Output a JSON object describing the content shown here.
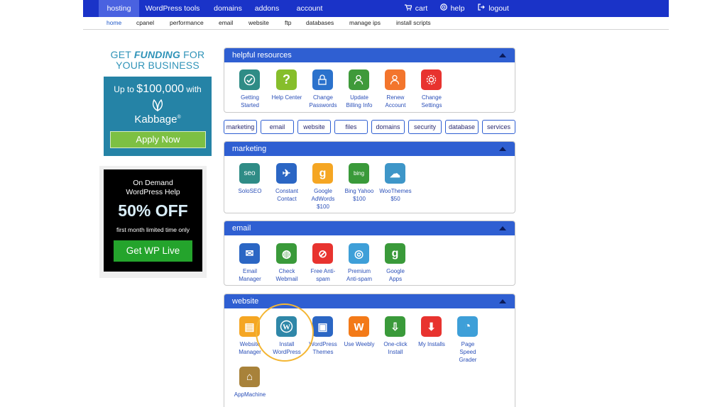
{
  "topnav": {
    "items": [
      {
        "label": "hosting"
      },
      {
        "label": "WordPress tools"
      },
      {
        "label": "domains"
      },
      {
        "label": "addons"
      },
      {
        "label": "account"
      }
    ],
    "cart": "cart",
    "help": "help",
    "logout": "logout"
  },
  "subnav": {
    "items": [
      {
        "label": "home"
      },
      {
        "label": "cpanel"
      },
      {
        "label": "performance"
      },
      {
        "label": "email"
      },
      {
        "label": "website"
      },
      {
        "label": "ftp"
      },
      {
        "label": "databases"
      },
      {
        "label": "manage ips"
      },
      {
        "label": "install scripts"
      }
    ]
  },
  "ads": {
    "kabbage": {
      "line1_pre": "GET ",
      "line1_bold": "FUNDING",
      "line1_post": " FOR",
      "line2": "YOUR BUSINESS",
      "upto": "Up to ",
      "amount": "$100,000",
      "with": " with",
      "brand": "Kabbage",
      "trademark": "®",
      "button": "Apply Now"
    },
    "wplive": {
      "line1": "On Demand",
      "line2": "WordPress Help",
      "offer": "50% OFF",
      "note": "first month limited time only",
      "button": "Get WP Live"
    }
  },
  "panels": {
    "helpful": {
      "title": "helpful resources",
      "tiles": [
        {
          "line1": "Getting",
          "line2": "Started",
          "icon": "checkmark-icon",
          "color": "#2f8c86"
        },
        {
          "line1": "Help Center",
          "line2": "",
          "icon": "question-icon",
          "color": "#86be2b"
        },
        {
          "line1": "Change",
          "line2": "Passwords",
          "icon": "lock-gear-icon",
          "color": "#2b72cc"
        },
        {
          "line1": "Update",
          "line2": "Billing Info",
          "icon": "user-gear-icon",
          "color": "#3f9a3a"
        },
        {
          "line1": "Renew",
          "line2": "Account",
          "icon": "user-clock-icon",
          "color": "#f3752c"
        },
        {
          "line1": "Change",
          "line2": "Settings",
          "icon": "gear-icon",
          "color": "#e8332f"
        }
      ]
    },
    "tags": [
      "marketing",
      "email",
      "website",
      "files",
      "domains",
      "security",
      "database",
      "services"
    ],
    "marketing": {
      "title": "marketing",
      "tiles": [
        {
          "line1": "SoloSEO",
          "line2": "",
          "line3": "",
          "glyph": "seo",
          "icon": "seo-icon",
          "color": "#2f8c86"
        },
        {
          "line1": "Constant",
          "line2": "Contact",
          "line3": "",
          "glyph": "✈",
          "icon": "paper-plane-icon",
          "color": "#2b66c4"
        },
        {
          "line1": "Google",
          "line2": "AdWords",
          "line3": "$100",
          "glyph": "g",
          "icon": "google-icon",
          "color": "#f5a623"
        },
        {
          "line1": "Bing Yahoo",
          "line2": "$100",
          "line3": "",
          "glyph": "bing",
          "icon": "bing-yahoo-icon",
          "color": "#3a9a3a"
        },
        {
          "line1": "WooThemes",
          "line2": "$50",
          "line3": "",
          "glyph": "☁",
          "icon": "woothemes-icon",
          "color": "#3e96c8"
        }
      ]
    },
    "email": {
      "title": "email",
      "tiles": [
        {
          "line1": "Email",
          "line2": "Manager",
          "glyph": "✉",
          "icon": "email-manager-icon",
          "color": "#2b66c4"
        },
        {
          "line1": "Check",
          "line2": "Webmail",
          "glyph": "◍",
          "icon": "webmail-icon",
          "color": "#3a9a3a"
        },
        {
          "line1": "Free Anti-",
          "line2": "spam",
          "glyph": "⊘",
          "icon": "antispam-icon",
          "color": "#e8332f"
        },
        {
          "line1": "Premium",
          "line2": "Anti-spam",
          "glyph": "◎",
          "icon": "premium-antispam-icon",
          "color": "#3e9fd8"
        },
        {
          "line1": "Google",
          "line2": "Apps",
          "glyph": "g",
          "icon": "google-apps-icon",
          "color": "#3a9a3a"
        }
      ]
    },
    "website": {
      "title": "website",
      "tiles": [
        {
          "line1": "Website",
          "line2": "Manager",
          "line3": "",
          "glyph": "▤",
          "icon": "website-manager-icon",
          "color": "#f5a623"
        },
        {
          "line1": "Install",
          "line2": "WordPress",
          "line3": "",
          "glyph": "W",
          "icon": "wordpress-icon",
          "color": "#2f87a8"
        },
        {
          "line1": "WordPress",
          "line2": "Themes",
          "line3": "",
          "glyph": "▣",
          "icon": "wordpress-themes-icon",
          "color": "#2b66c4"
        },
        {
          "line1": "Use Weebly",
          "line2": "",
          "line3": "",
          "glyph": "w",
          "icon": "weebly-icon",
          "color": "#f37a18"
        },
        {
          "line1": "One-click",
          "line2": "Install",
          "line3": "",
          "glyph": "⇩",
          "icon": "one-click-install-icon",
          "color": "#3a9a3a"
        },
        {
          "line1": "My Installs",
          "line2": "",
          "line3": "",
          "glyph": "⬇",
          "icon": "my-installs-icon",
          "color": "#e8332f"
        },
        {
          "line1": "Page",
          "line2": "Speed",
          "line3": "Grader",
          "glyph": "◔",
          "icon": "page-speed-icon",
          "color": "#3e9fd8"
        },
        {
          "line1": "AppMachine",
          "line2": "",
          "line3": "",
          "glyph": "⌂",
          "icon": "appmachine-icon",
          "color": "#a8823a"
        }
      ]
    }
  }
}
